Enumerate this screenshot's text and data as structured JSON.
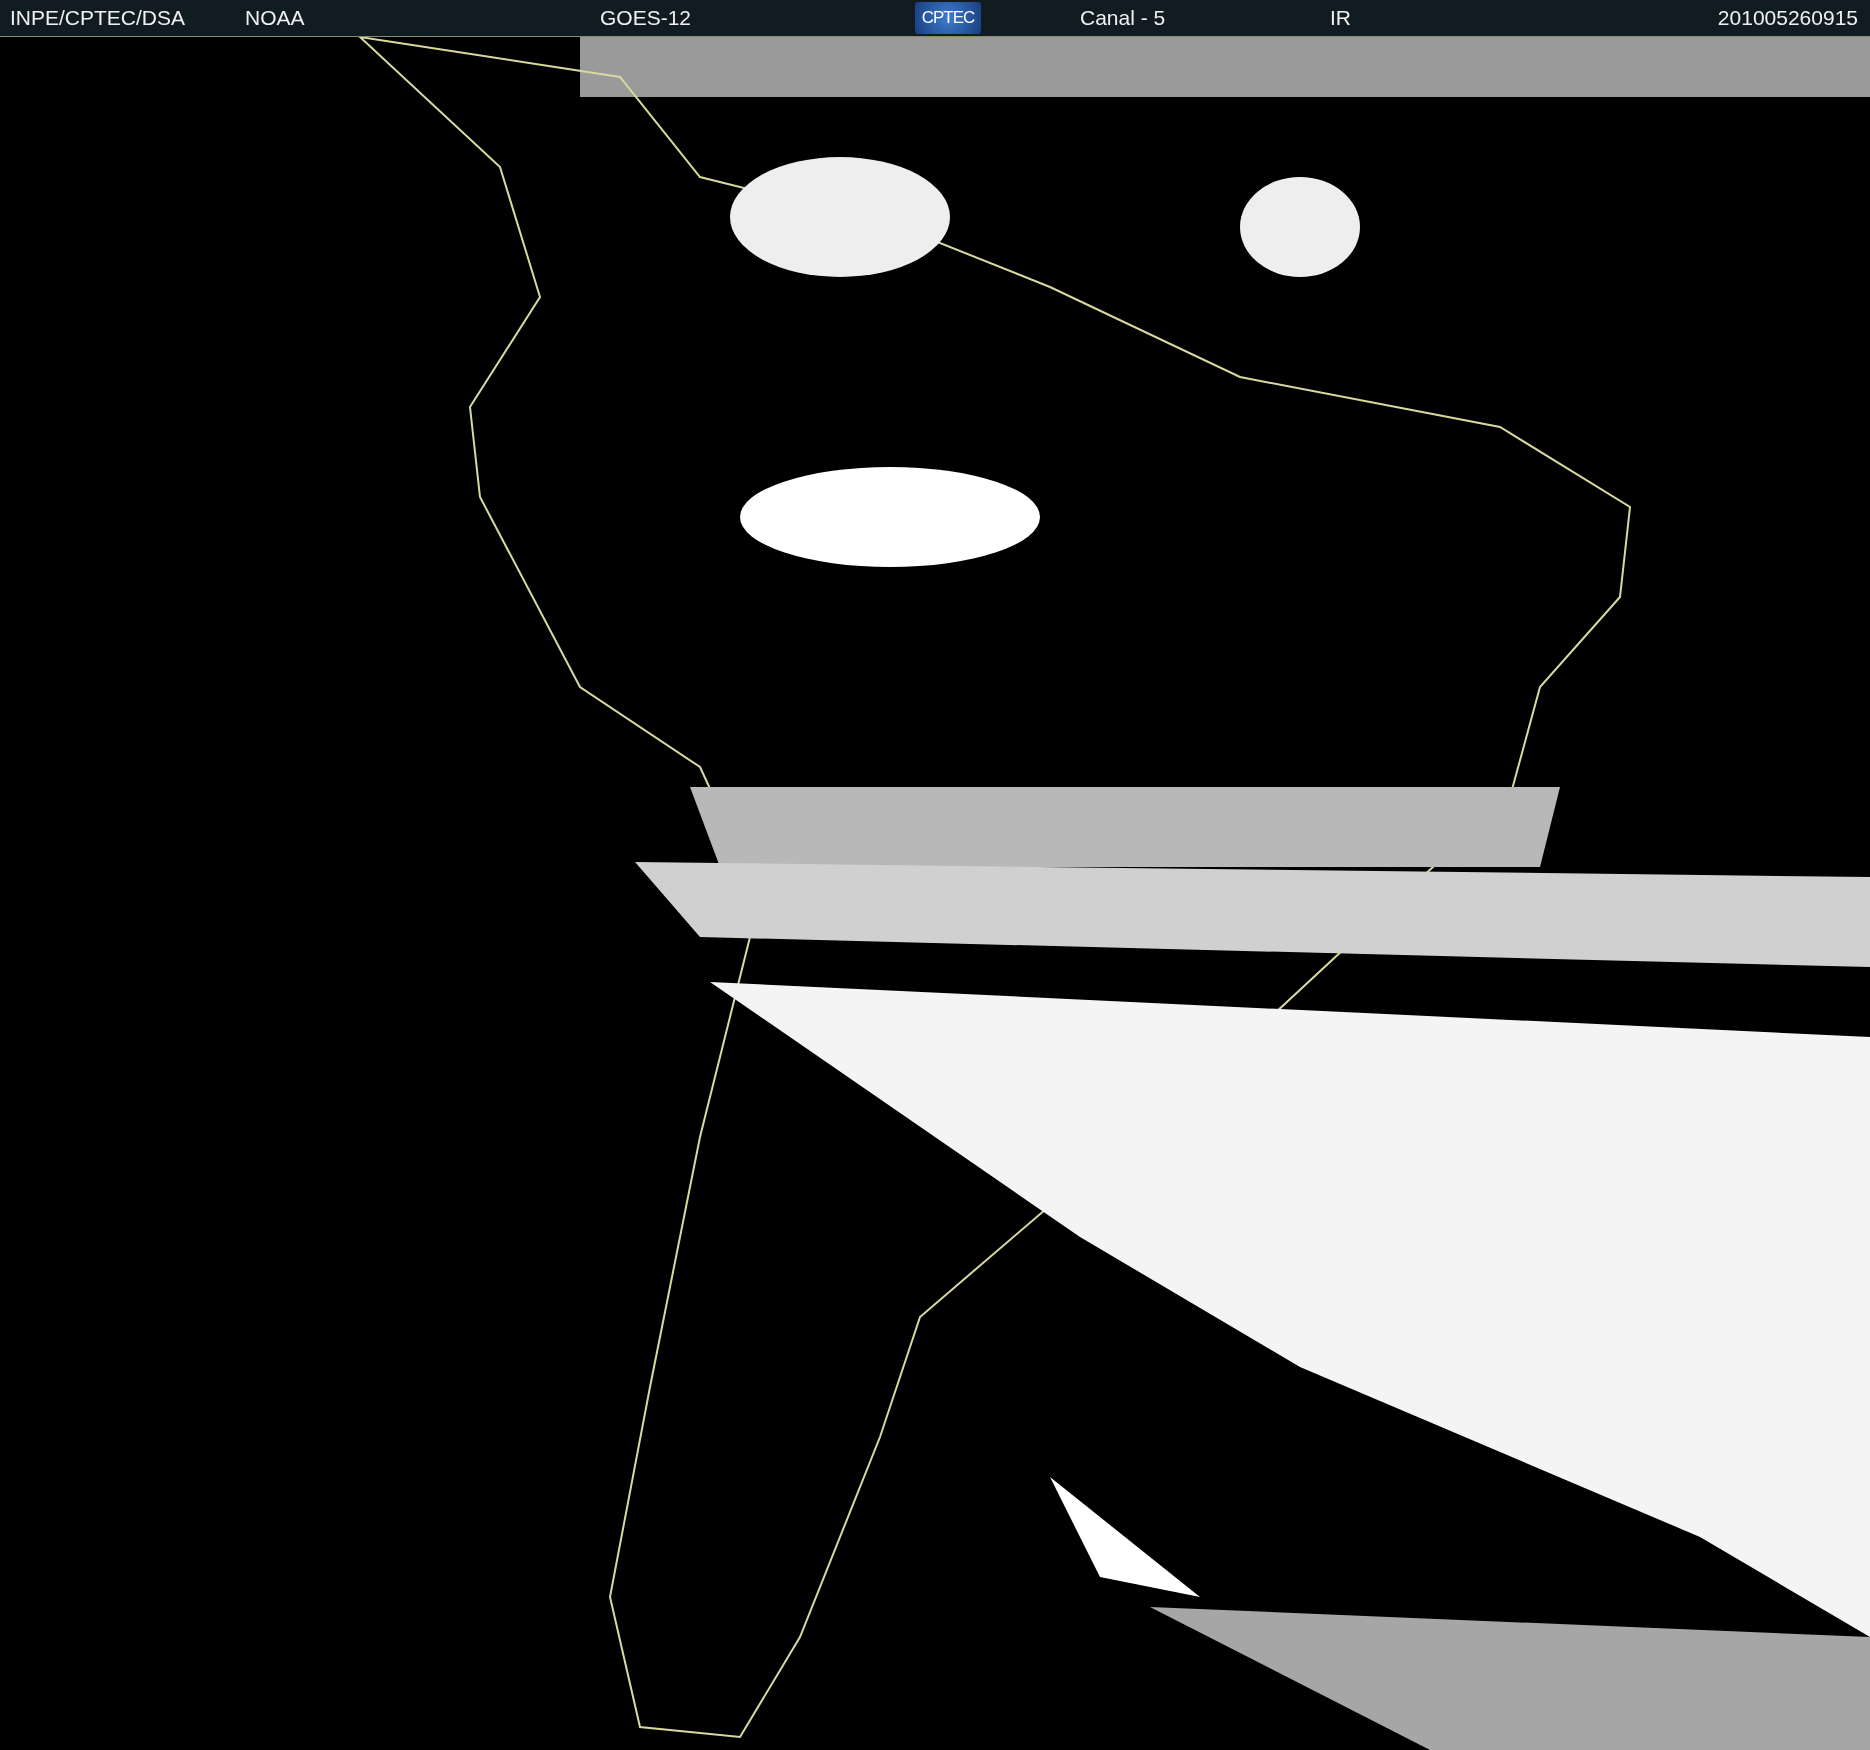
{
  "header": {
    "source": "INPE/CPTEC/DSA",
    "agency": "NOAA",
    "satellite": "GOES-12",
    "logo": "CPTEC",
    "channel": "Canal - 5",
    "band": "IR",
    "timestamp": "201005260915"
  }
}
